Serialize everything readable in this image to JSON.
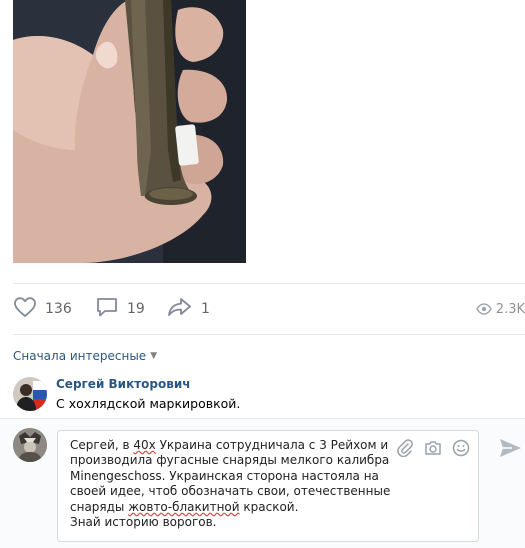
{
  "post": {
    "likes_count": "136",
    "comments_count": "19",
    "shares_count": "1",
    "views_count": "2.3K"
  },
  "comments_sort": {
    "label": "Сначала интересные",
    "chevron": "chevron-down-icon"
  },
  "comment": {
    "author": "Сергей Викторович",
    "text": "С хохлядской маркировкой."
  },
  "reply": {
    "p1": "Сергей, в ",
    "p2": "40х",
    "p3": " Украина сотрудничала с 3 Рейхом и\nпроизводила фугасные снаряды мелкого калибра\nMinengeschoss. Украинская сторона настояла на\nсвоей идее, чтоб обозначать свои, отечественные\nснаряды ",
    "p4": "жовто-блакитной",
    "p5": " краской.\nЗнай историю ворогов.",
    "icons": [
      "paperclip-icon",
      "camera-icon",
      "smile-icon"
    ]
  },
  "icons": {
    "like": "heart-icon",
    "comment": "comment-bubble-icon",
    "share": "share-arrow-icon",
    "views": "eye-icon",
    "send": "send-icon"
  },
  "colors": {
    "link": "#2a5885",
    "action_icon": "#828a99",
    "border": "#e7e8ec"
  }
}
